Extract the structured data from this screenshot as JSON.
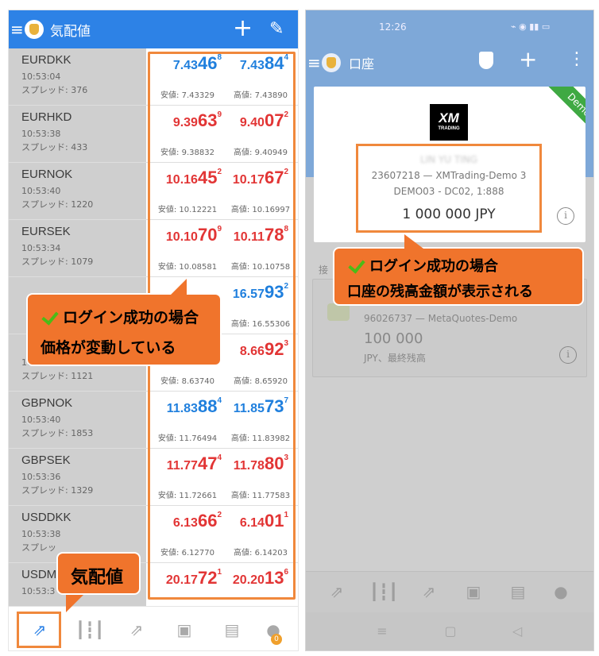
{
  "left": {
    "header_title": "気配値",
    "quotes": [
      {
        "symbol": "EURDKK",
        "time": "10:53:04",
        "spread": "スプレッド: 376",
        "bid_small": "7.43",
        "bid_big": "46",
        "bid_sup": "8",
        "ask_small": "7.43",
        "ask_big": "84",
        "ask_sup": "4",
        "low": "安値: 7.43329",
        "high": "高値: 7.43890",
        "bid_color": "blue",
        "ask_color": "blue"
      },
      {
        "symbol": "EURHKD",
        "time": "10:53:38",
        "spread": "スプレッド: 433",
        "bid_small": "9.39",
        "bid_big": "63",
        "bid_sup": "9",
        "ask_small": "9.40",
        "ask_big": "07",
        "ask_sup": "2",
        "low": "安値: 9.38832",
        "high": "高値: 9.40949",
        "bid_color": "red",
        "ask_color": "red"
      },
      {
        "symbol": "EURNOK",
        "time": "10:53:40",
        "spread": "スプレッド: 1220",
        "bid_small": "10.16",
        "bid_big": "45",
        "bid_sup": "2",
        "ask_small": "10.17",
        "ask_big": "67",
        "ask_sup": "2",
        "low": "安値: 10.12221",
        "high": "高値: 10.16997",
        "bid_color": "red",
        "ask_color": "red"
      },
      {
        "symbol": "EURSEK",
        "time": "10:53:34",
        "spread": "スプレッド: 1079",
        "bid_small": "10.10",
        "bid_big": "70",
        "bid_sup": "9",
        "ask_small": "10.11",
        "ask_big": "78",
        "ask_sup": "8",
        "low": "安値: 10.08581",
        "high": "高値: 10.10758",
        "bid_color": "red",
        "ask_color": "red"
      },
      {
        "symbol": "",
        "time": "",
        "spread": "",
        "bid_small": "",
        "bid_big": "",
        "bid_sup": "",
        "ask_small": "16.57",
        "ask_big": "93",
        "ask_sup": "2",
        "low": "",
        "high": "高値: 16.55306",
        "bid_color": "blue",
        "ask_color": "blue"
      },
      {
        "symbol": "",
        "time": "10:53:38",
        "spread": "スプレッド: 1121",
        "bid_small": "",
        "bid_big": "",
        "bid_sup": "",
        "ask_small": "8.66",
        "ask_big": "92",
        "ask_sup": "3",
        "low": "安値: 8.63740",
        "high": "高値: 8.65920",
        "bid_color": "red",
        "ask_color": "red"
      },
      {
        "symbol": "GBPNOK",
        "time": "10:53:40",
        "spread": "スプレッド: 1853",
        "bid_small": "11.83",
        "bid_big": "88",
        "bid_sup": "4",
        "ask_small": "11.85",
        "ask_big": "73",
        "ask_sup": "7",
        "low": "安値: 11.76494",
        "high": "高値: 11.83982",
        "bid_color": "blue",
        "ask_color": "blue"
      },
      {
        "symbol": "GBPSEK",
        "time": "10:53:36",
        "spread": "スプレッド: 1329",
        "bid_small": "11.77",
        "bid_big": "47",
        "bid_sup": "4",
        "ask_small": "11.78",
        "ask_big": "80",
        "ask_sup": "3",
        "low": "安値: 11.72661",
        "high": "高値: 11.77583",
        "bid_color": "red",
        "ask_color": "red"
      },
      {
        "symbol": "USDDKK",
        "time": "10:53:38",
        "spread": "スプレッ",
        "bid_small": "6.13",
        "bid_big": "66",
        "bid_sup": "2",
        "ask_small": "6.14",
        "ask_big": "01",
        "ask_sup": "1",
        "low": "安値: 6.12770",
        "high": "高値: 6.14203",
        "bid_color": "red",
        "ask_color": "red"
      },
      {
        "symbol": "USDM",
        "time": "10:53:3",
        "spread": "",
        "bid_small": "20.17",
        "bid_big": "72",
        "bid_sup": "1",
        "ask_small": "20.20",
        "ask_big": "13",
        "ask_sup": "6",
        "low": "",
        "high": "",
        "bid_color": "red",
        "ask_color": "red"
      }
    ],
    "callout_price": {
      "line1": "ログイン成功の場合",
      "line2": "価格が変動している"
    },
    "callout_quotes": "気配値",
    "nav_badge": "0"
  },
  "right": {
    "status_time": "12:26",
    "status_icons": "⌁ ◉ ▮▮ ▭",
    "header_title": "口座",
    "demo_label": "Demo",
    "xm_logo": "XM",
    "xm_sub": "TRADING",
    "account_name": "LIN YU TING",
    "account_line1": "23607218 — XMTrading-Demo 3",
    "account_line2": "DEMO03 - DC02, 1:888",
    "account_balance": "1 000 000 JPY",
    "section_label": "接",
    "account2_number": "96026737 — MetaQuotes-Demo",
    "account2_balance": "100 000",
    "account2_sub": "JPY、最終残高",
    "callout": {
      "line1": "ログイン成功の場合",
      "line2": "口座の残高金額が表示される"
    }
  },
  "colors": {
    "header": "#2d82e6",
    "callout": "#f0742c",
    "frame": "#f0883c",
    "bid_blue": "#1f7fdd",
    "ask_red": "#e23535"
  }
}
